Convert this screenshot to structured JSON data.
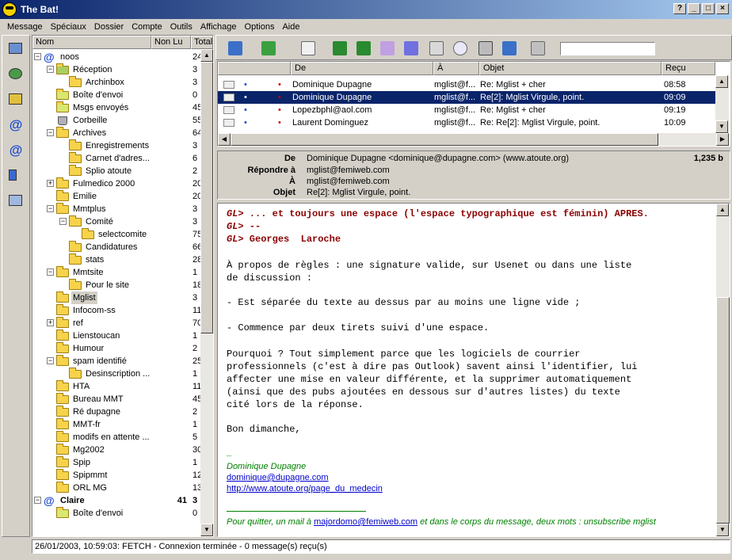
{
  "window": {
    "title": "The Bat!"
  },
  "menu": [
    "Message",
    "Spéciaux",
    "Dossier",
    "Compte",
    "Outils",
    "Affichage",
    "Options",
    "Aide"
  ],
  "tree": {
    "headers": {
      "name": "Nom",
      "unread": "Non Lu",
      "total": "Total"
    },
    "items": [
      {
        "label": "noos",
        "level": 0,
        "count": "24",
        "exp": "−",
        "icon": "at"
      },
      {
        "label": "Réception",
        "level": 1,
        "count": "3",
        "exp": "−",
        "icon": "inbox"
      },
      {
        "label": "Archinbox",
        "level": 2,
        "count": "3",
        "icon": "folder"
      },
      {
        "label": "Boîte d'envoi",
        "level": 1,
        "count": "0",
        "icon": "outbox"
      },
      {
        "label": "Msgs envoyés",
        "level": 1,
        "count": "45",
        "icon": "sent"
      },
      {
        "label": "Corbeille",
        "level": 1,
        "count": "55",
        "icon": "trash"
      },
      {
        "label": "Archives",
        "level": 1,
        "count": "64",
        "exp": "−",
        "icon": "folder"
      },
      {
        "label": "Enregistrements",
        "level": 2,
        "count": "3",
        "icon": "folder"
      },
      {
        "label": "Carnet d'adres...",
        "level": 2,
        "count": "6",
        "icon": "folder"
      },
      {
        "label": "Splio atoute",
        "level": 2,
        "count": "2",
        "icon": "folder"
      },
      {
        "label": "Fulmedico 2000",
        "level": 1,
        "count": "20",
        "exp": "+",
        "icon": "folder"
      },
      {
        "label": "Emilie",
        "level": 1,
        "count": "20",
        "icon": "folder"
      },
      {
        "label": "Mmtplus",
        "level": 1,
        "count": "3",
        "exp": "−",
        "icon": "folder"
      },
      {
        "label": "Comité",
        "level": 2,
        "count": "3",
        "exp": "−",
        "icon": "folder"
      },
      {
        "label": "selectcomite",
        "level": 3,
        "count": "75",
        "icon": "folder"
      },
      {
        "label": "Candidatures",
        "level": 2,
        "count": "66",
        "icon": "folder"
      },
      {
        "label": "stats",
        "level": 2,
        "count": "28",
        "icon": "folder"
      },
      {
        "label": "Mmtsite",
        "level": 1,
        "count": "1",
        "exp": "−",
        "icon": "folder"
      },
      {
        "label": "Pour le site",
        "level": 2,
        "count": "18",
        "icon": "folder"
      },
      {
        "label": "Mglist",
        "level": 1,
        "count": "3",
        "icon": "folder",
        "selected": true
      },
      {
        "label": "Infocom-ss",
        "level": 1,
        "count": "11",
        "icon": "folder"
      },
      {
        "label": "ref",
        "level": 1,
        "count": "70",
        "exp": "+",
        "icon": "folder"
      },
      {
        "label": "Lienstoucan",
        "level": 1,
        "count": "1",
        "icon": "folder"
      },
      {
        "label": "Humour",
        "level": 1,
        "count": "2",
        "icon": "folder"
      },
      {
        "label": "spam identifié",
        "level": 1,
        "count": "25",
        "exp": "−",
        "icon": "folder"
      },
      {
        "label": "Desinscription ...",
        "level": 2,
        "count": "1",
        "icon": "folder"
      },
      {
        "label": "HTA",
        "level": 1,
        "count": "11",
        "icon": "folder"
      },
      {
        "label": "Bureau MMT",
        "level": 1,
        "count": "45",
        "icon": "folder"
      },
      {
        "label": "Ré dupagne",
        "level": 1,
        "count": "2",
        "icon": "folder"
      },
      {
        "label": "MMT-fr",
        "level": 1,
        "count": "1",
        "icon": "folder"
      },
      {
        "label": "modifs en attente ...",
        "level": 1,
        "count": "5",
        "icon": "folder"
      },
      {
        "label": "Mg2002",
        "level": 1,
        "count": "30",
        "icon": "folder"
      },
      {
        "label": "Spip",
        "level": 1,
        "count": "1",
        "icon": "folder"
      },
      {
        "label": "Spipmmt",
        "level": 1,
        "count": "12",
        "icon": "folder"
      },
      {
        "label": "ORL MG",
        "level": 1,
        "count": "13",
        "icon": "folder"
      },
      {
        "label": "Claire",
        "level": 0,
        "count": "3",
        "exp": "−",
        "icon": "at",
        "unread": "41",
        "bold": true
      },
      {
        "label": "Boîte d'envoi",
        "level": 1,
        "count": "0",
        "icon": "outbox"
      }
    ]
  },
  "messages": {
    "headers": {
      "from": "De",
      "to": "À",
      "subject": "Objet",
      "received": "Reçu"
    },
    "rows": [
      {
        "from": "Dominique Dupagne",
        "to": "mglist@f...",
        "subject": "Re: Mglist + cher",
        "time": "08:58"
      },
      {
        "from": "Dominique Dupagne",
        "to": "mglist@f...",
        "subject": "Re[2]: Mglist Virgule, point.",
        "time": "09:09",
        "selected": true
      },
      {
        "from": "Lopezbphl@aol.com",
        "to": "mglist@f...",
        "subject": "Re: Mglist + cher",
        "time": "09:19"
      },
      {
        "from": "Laurent Dominguez",
        "to": "mglist@f...",
        "subject": "Re: Re[2]: Mglist Virgule, point.",
        "time": "10:09"
      }
    ]
  },
  "header_panel": {
    "from_label": "De",
    "from": "Dominique Dupagne <dominique@dupagne.com>  (www.atoute.org)",
    "size": "1,235 b",
    "reply_label": "Répondre à",
    "reply": "mglist@femiweb.com",
    "to_label": "À",
    "to": "mglist@femiweb.com",
    "subject_label": "Objet",
    "subject": "Re[2]: Mglist Virgule, point."
  },
  "body": {
    "q1_gl": "GL>",
    "q1": " ... et toujours une espace (l'espace typographique est féminin) APRES.",
    "q2_gl": "GL>",
    "q2": " --",
    "q3_gl": "GL>",
    "q3": " Georges  Laroche",
    "p1": "À propos de règles : une signature valide, sur Usenet ou dans une liste\nde discussion :",
    "p2": "- Est séparée du texte au dessus par au moins une ligne vide ;",
    "p3": "- Commence par deux tirets suivi d'une espace.",
    "p4": "Pourquoi ? Tout simplement parce que les logiciels de courrier\nprofessionnels (c'est à dire pas Outlook) savent ainsi l'identifier, lui\naffecter une mise en valeur différente, et la supprimer automatiquement\n(ainsi que des pubs ajoutées en dessous sur d'autres listes) du texte\ncité lors de la réponse.",
    "p5": "Bon dimanche,",
    "sig_dash": "_",
    "sig_name": "Dominique Dupagne",
    "sig_email": "dominique@dupagne.com",
    "sig_url": "http://www.atoute.org/page_du_medecin",
    "footer_a": "Pour quitter, un mail à ",
    "footer_link": "majordomo@femiweb.com",
    "footer_b": " et dans le corps du message, deux mots : unsubscribe mglist"
  },
  "status": "26/01/2003, 10:59:03: FETCH - Connexion terminée - 0 message(s) reçu(s)"
}
